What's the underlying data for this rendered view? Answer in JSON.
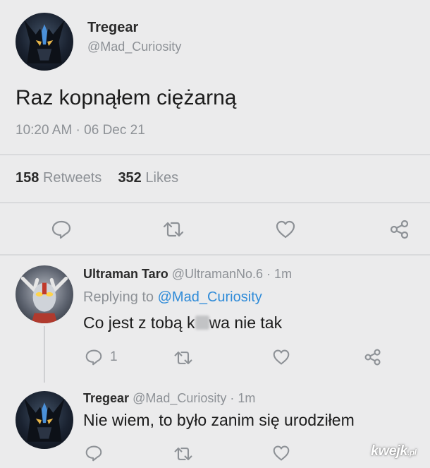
{
  "main_tweet": {
    "author_name": "Tregear",
    "author_handle": "@Mad_Curiosity",
    "text": "Raz kopnąłem ciężarną",
    "timestamp": "10:20 AM · 06 Dec 21",
    "retweets_count": "158",
    "retweets_label": "Retweets",
    "likes_count": "352",
    "likes_label": "Likes",
    "actions": [
      "reply-icon",
      "retweet-icon",
      "heart-icon",
      "share-icon"
    ]
  },
  "reply_1": {
    "author_name": "Ultraman Taro",
    "author_handle": "@UltramanNo.6",
    "time": "· 1m",
    "replying_label": "Replying to",
    "replying_handle": "@Mad_Curiosity",
    "text_before": "Co jest z tobą k",
    "text_after": "wa nie tak",
    "reply_count": "1"
  },
  "reply_2": {
    "author_name": "Tregear",
    "author_handle": "@Mad_Curiosity",
    "time": "· 1m",
    "text": "Nie wiem, to było zanim się urodziłem"
  },
  "watermark": {
    "text": "kwejk",
    "suffix": ".pl"
  },
  "colors": {
    "background": "#ebebec",
    "link": "#2f8bd8",
    "muted": "#8d9196"
  }
}
